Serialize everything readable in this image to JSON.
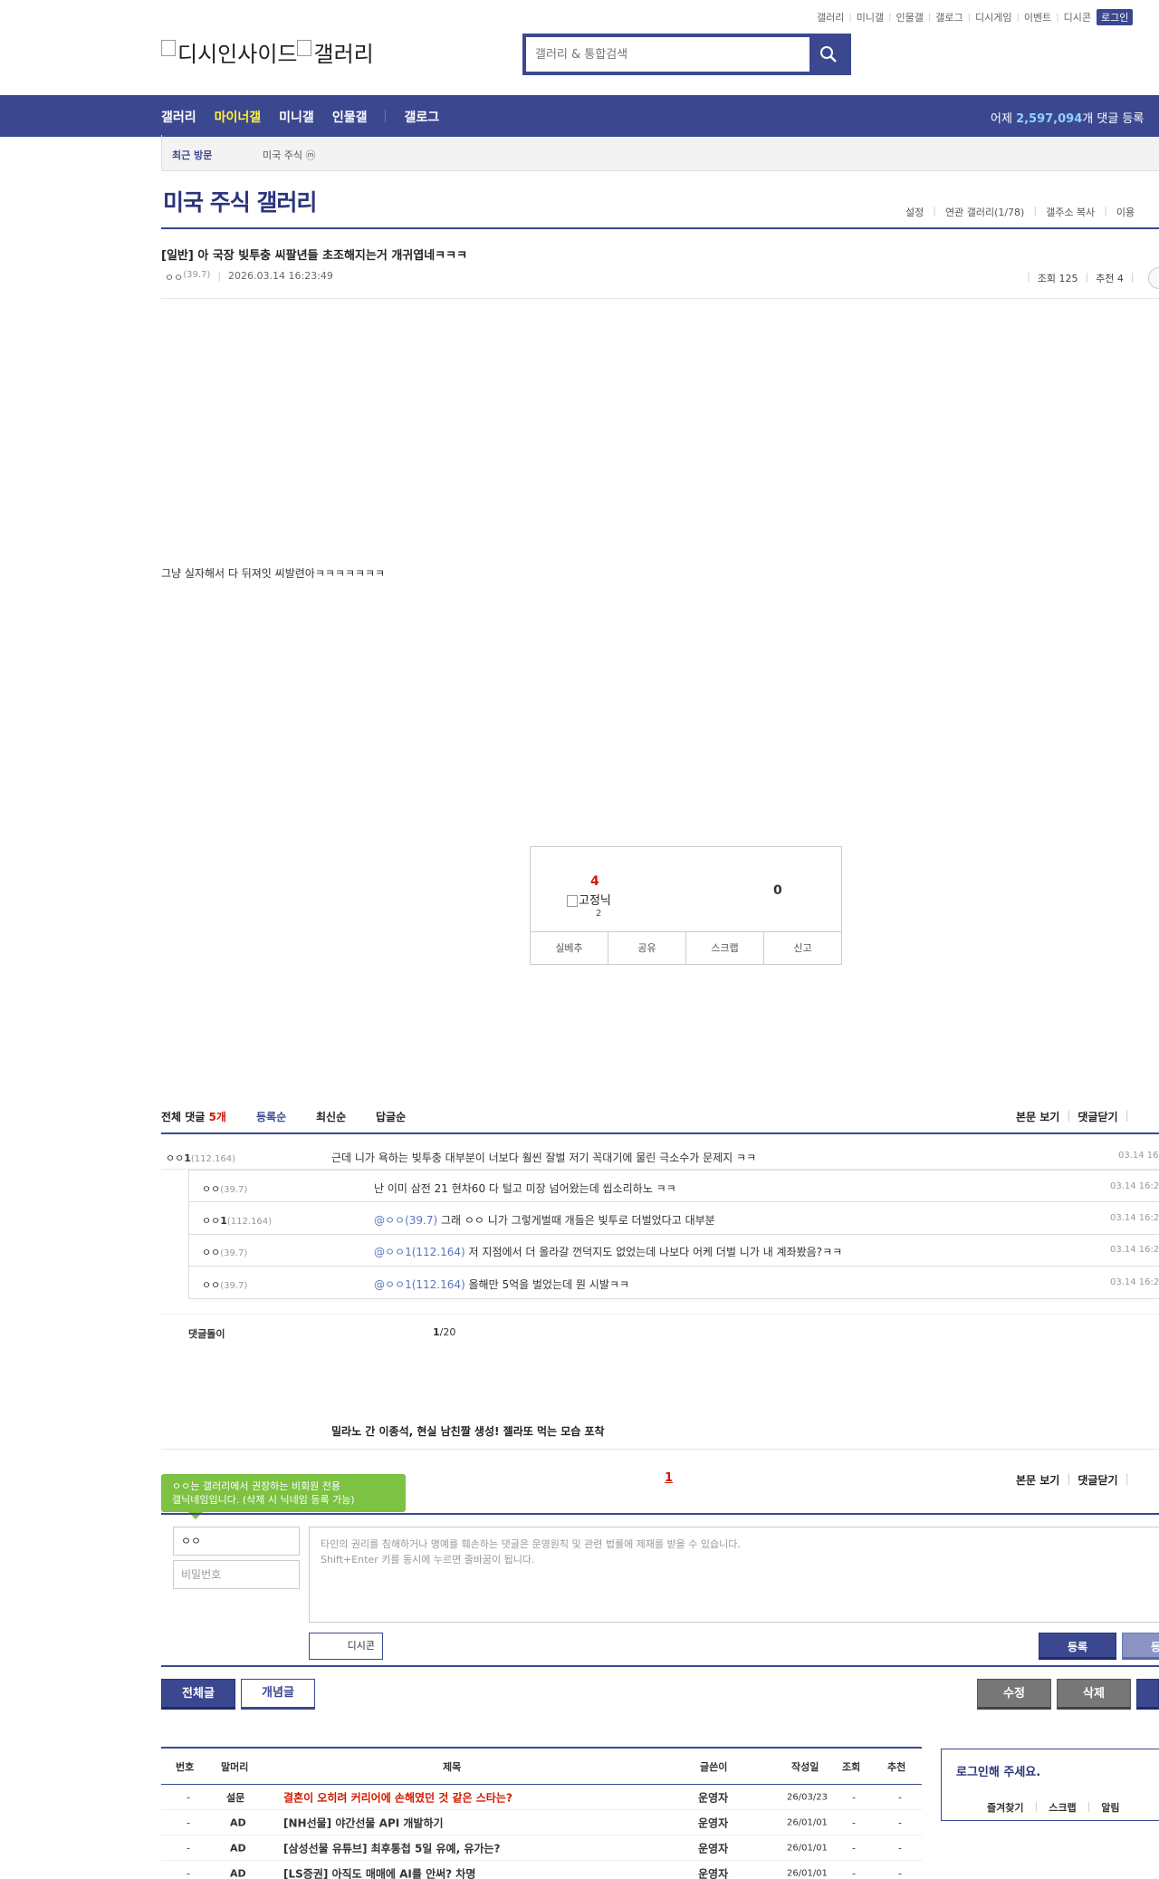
{
  "topnav": [
    "갤러리",
    "미니갤",
    "인물갤",
    "갤로그",
    "디시게임",
    "이벤트",
    "디시콘"
  ],
  "login_label": "로그인",
  "logo": {
    "text1": "디시인사이드",
    "text2": "갤러리"
  },
  "search": {
    "placeholder": "갤러리 & 통합검색"
  },
  "mainmenu": {
    "gallery": "갤러리",
    "minor": "마이너갤",
    "mini": "미니갤",
    "person": "인물갤",
    "gallog": "갤로그"
  },
  "stat": {
    "prefix": "어제 ",
    "count": "2,597,094",
    "suffix": "개 댓글 등록"
  },
  "recent": {
    "label": "최근 방문",
    "item": "미국 주식 ⓜ"
  },
  "gallery_title": "미국 주식 갤러리",
  "gall_tools": [
    "설정",
    "연관 갤러리(1/78)",
    "갤주소 복사",
    "이용"
  ],
  "post": {
    "title": "[일반] 아 국장 빚투충 씨팔년들 초조해지는거 개귀엽네ㅋㅋㅋ",
    "writer": "ㅇㅇ",
    "writer_ip": "(39.7)",
    "date": "2026.03.14 16:23:49",
    "views": "조회 125",
    "recommend": "추천 4",
    "body": "그냥 실자해서 다 뒤져잇 씨발련아ㅋㅋㅋㅋㅋㅋㅋ"
  },
  "recommend_box": {
    "up": "4",
    "gaenyeom_text": "고정닉",
    "fixed_count": "2",
    "down": "0",
    "buttons": [
      "실베추",
      "공유",
      "스크랩",
      "신고"
    ]
  },
  "comments": {
    "total_label": "전체 댓글",
    "total_count": "5개",
    "sort_reg": "등록순",
    "sort_new": "최신순",
    "sort_reply": "답글순",
    "view_body": "본문 보기",
    "close": "댓글닫기",
    "main": {
      "nick": "ㅇㅇ",
      "nick_bold": "1",
      "ip": "(112.164)",
      "text": "근데 니가 욕하는 빚투충 대부분이 너보다 훨씬 잘벌 저기 꼭대기에 물린 극소수가 문제지 ㅋㅋ",
      "date": "03.14 16"
    },
    "replies": [
      {
        "nick": "ㅇㅇ",
        "nick_bold": "",
        "ip": "(39.7)",
        "mention": "",
        "text": "난 이미 삼전 21 현차60 다 털고 미장 넘어왔는데 씹소리하노 ㅋㅋ",
        "date": "03.14 16:2"
      },
      {
        "nick": "ㅇㅇ",
        "nick_bold": "1",
        "ip": "(112.164)",
        "mention": "@ㅇㅇ(39.7)",
        "text": " 그래 ㅇㅇ 니가 그렇게벌때 개들은 빚투로 더벌었다고 대부분",
        "date": "03.14 16:2"
      },
      {
        "nick": "ㅇㅇ",
        "nick_bold": "",
        "ip": "(39.7)",
        "mention": "@ㅇㅇ1(112.164)",
        "text": " 저 지점에서 더 올라갈 껀덕지도 없었는데 나보다 어케 더벌 니가 내 계좌봤음?ㅋㅋ",
        "date": "03.14 16:2"
      },
      {
        "nick": "ㅇㅇ",
        "nick_bold": "",
        "ip": "(39.7)",
        "mention": "@ㅇㅇ1(112.164)",
        "text": " 올해만 5억을 벌었는데 뭔 시발ㅋㅋ",
        "date": "03.14 16:2"
      }
    ],
    "foot_label": "댓글돌이",
    "page": "1",
    "page_total": "/20"
  },
  "promo": "밀라노 간 이종석, 현실 남친짤 생성! 젤라또 먹는 모습 포착",
  "page_one": "1",
  "write": {
    "tooltip_line1": "ㅇㅇ는 갤러리에서 권장하는 비회원 전용",
    "tooltip_line2": "갤닉네임입니다. (삭제 시 닉네임 등록 가능)",
    "nick_value": "ㅇㅇ",
    "pw_placeholder": "비밀번호",
    "notice1": "타인의 권리를 침해하거나 명예를 훼손하는 댓글은 운영원칙 및 관련 법률에 제재를 받을 수 있습니다.",
    "notice2": "Shift+Enter 키를 동시에 누르면 줄바꿈이 됩니다.",
    "dccon": "디시콘",
    "submit": "등록",
    "submit2": "등록"
  },
  "list_buttons": {
    "all": "전체글",
    "concept": "개념글",
    "edit": "수정",
    "delete": "삭제"
  },
  "list": {
    "headers": [
      "번호",
      "말머리",
      "제목",
      "글쓴이",
      "작성일",
      "조회",
      "추천"
    ],
    "rows": [
      {
        "no": "-",
        "head": "설문",
        "title": "결혼이 오히려 커리어에 손해였던 것 같은 스타는?",
        "writer": "운영자",
        "date": "26/03/23",
        "views": "-",
        "rec": "-",
        "red": true
      },
      {
        "no": "-",
        "head": "AD",
        "title": "[NH선물] 야간선물 API 개발하기",
        "writer": "운영자",
        "date": "26/01/01",
        "views": "-",
        "rec": "-",
        "red": false
      },
      {
        "no": "-",
        "head": "AD",
        "title": "[삼성선물 유튜브] 최후통첩 5일 유예, 유가는?",
        "writer": "운영자",
        "date": "26/01/01",
        "views": "-",
        "rec": "-",
        "red": false
      },
      {
        "no": "-",
        "head": "AD",
        "title": "[LS증권] 아직도 매매에 AI를 안써? 차명",
        "writer": "운영자",
        "date": "26/01/01",
        "views": "-",
        "rec": "-",
        "red": false
      }
    ]
  },
  "side": {
    "login_msg": "로그인해 주세요.",
    "fav": "즐겨찾기",
    "scrap": "스크랩",
    "alarm": "알림"
  },
  "colors": {
    "brand": "#3b4890",
    "accent_red": "#d31900",
    "tooltip_green": "#7dc243"
  }
}
